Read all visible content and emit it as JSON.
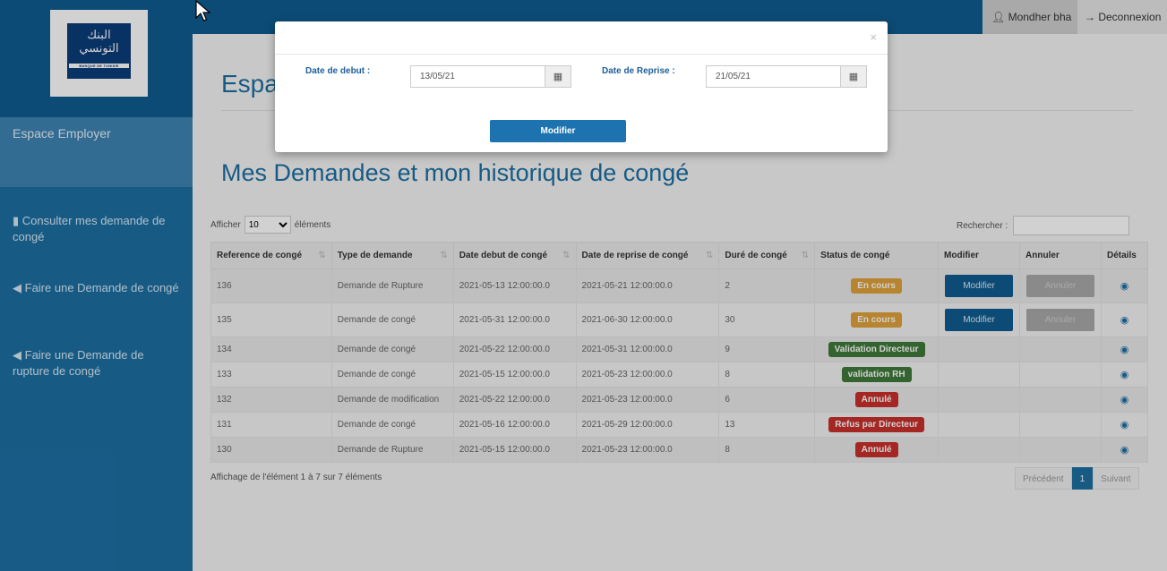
{
  "header": {
    "user_name": "Mondher bha",
    "logout_label": "Deconnexion",
    "user_icon": "user-icon",
    "logout_icon": "logout-icon"
  },
  "logo": {
    "arabic_text": "البنك التونسي",
    "latin_text": "BANQUE DE TUNISIE"
  },
  "sidebar": {
    "section_title": "Espace Employer",
    "items": [
      {
        "label": "Consulter mes demande de congé",
        "icon": "file-icon"
      },
      {
        "label": "Faire une Demande de congé",
        "icon": "bullhorn-icon"
      },
      {
        "label": "Faire une Demande de rupture de congé",
        "icon": "bullhorn-icon"
      }
    ]
  },
  "main": {
    "title_top": "Espa",
    "title": "Mes Demandes et mon historique de congé",
    "length_prefix": "Afficher",
    "length_value": "10",
    "length_suffix": "éléments",
    "search_label": "Rechercher :",
    "columns": [
      "Reference de congé",
      "Type de demande",
      "Date debut de congé",
      "Date de reprise de congé",
      "Duré de congé",
      "Status de congé",
      "Modifier",
      "Annuler",
      "Détails"
    ],
    "rows": [
      {
        "ref": "136",
        "type": "Demande de Rupture",
        "debut": "2021-05-13 12:00:00.0",
        "reprise": "2021-05-21 12:00:00.0",
        "duree": "2",
        "status": "En cours",
        "status_color": "#e0a23a",
        "modifier": "Modifier",
        "annuler": "Annuler"
      },
      {
        "ref": "135",
        "type": "Demande de congé",
        "debut": "2021-05-31 12:00:00.0",
        "reprise": "2021-06-30 12:00:00.0",
        "duree": "30",
        "status": "En cours",
        "status_color": "#e0a23a",
        "modifier": "Modifier",
        "annuler": "Annuler"
      },
      {
        "ref": "134",
        "type": "Demande de congé",
        "debut": "2021-05-22 12:00:00.0",
        "reprise": "2021-05-31 12:00:00.0",
        "duree": "9",
        "status": "Validation Directeur",
        "status_color": "#3f7a3a"
      },
      {
        "ref": "133",
        "type": "Demande de congé",
        "debut": "2021-05-15 12:00:00.0",
        "reprise": "2021-05-23 12:00:00.0",
        "duree": "8",
        "status": "validation RH",
        "status_color": "#3f7a3a"
      },
      {
        "ref": "132",
        "type": "Demande de modification",
        "debut": "2021-05-22 12:00:00.0",
        "reprise": "2021-05-23 12:00:00.0",
        "duree": "6",
        "status": "Annulé",
        "status_color": "#c9302c"
      },
      {
        "ref": "131",
        "type": "Demande de congé",
        "debut": "2021-05-16 12:00:00.0",
        "reprise": "2021-05-29 12:00:00.0",
        "duree": "13",
        "status": "Refus par Directeur",
        "status_color": "#c9302c"
      },
      {
        "ref": "130",
        "type": "Demande de Rupture",
        "debut": "2021-05-15 12:00:00.0",
        "reprise": "2021-05-23 12:00:00.0",
        "duree": "8",
        "status": "Annulé",
        "status_color": "#c9302c"
      }
    ],
    "info": "Affichage de l'élément 1 à 7 sur 7 éléments",
    "pager": {
      "prev": "Précédent",
      "page": "1",
      "next": "Suivant"
    }
  },
  "modal": {
    "close": "×",
    "date_debut_label": "Date de debut :",
    "date_debut_value": "13/05/21",
    "date_reprise_label": "Date de Reprise :",
    "date_reprise_value": "21/05/21",
    "submit_label": "Modifier",
    "calendar_icon": "calendar-icon"
  }
}
